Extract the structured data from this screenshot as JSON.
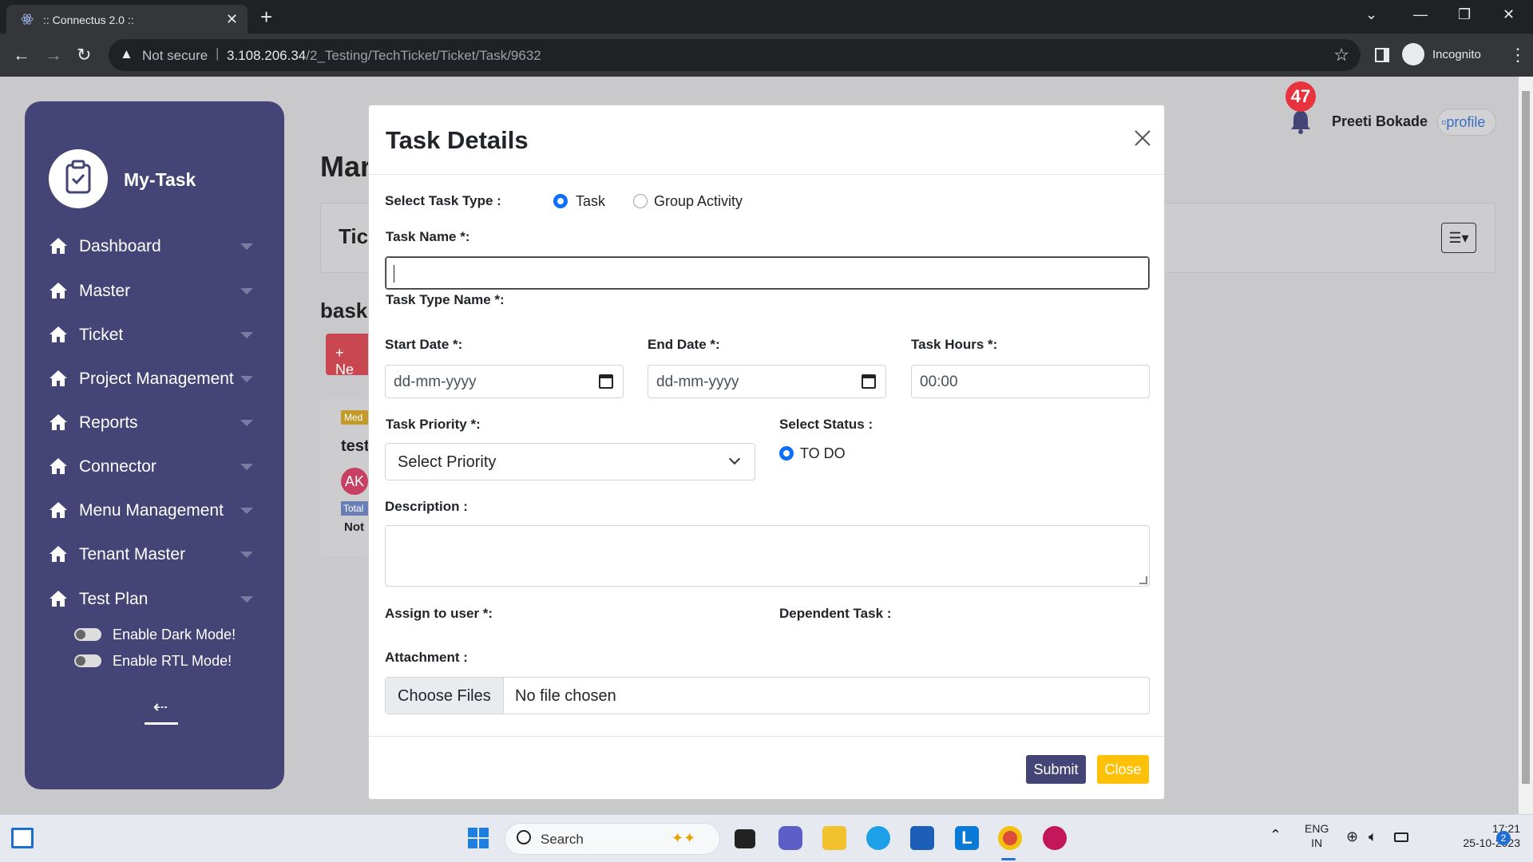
{
  "browser": {
    "tab_title": ":: Connectus 2.0 ::",
    "not_secure": "Not secure",
    "url_host": "3.108.206.34",
    "url_path": "/2_Testing/TechTicket/Ticket/Task/9632",
    "incognito": "Incognito"
  },
  "sidebar": {
    "brand": "My-Task",
    "items": [
      {
        "label": "Dashboard"
      },
      {
        "label": "Master"
      },
      {
        "label": "Ticket"
      },
      {
        "label": "Project Management"
      },
      {
        "label": "Reports"
      },
      {
        "label": "Connector"
      },
      {
        "label": "Menu Management"
      },
      {
        "label": "Tenant Master"
      },
      {
        "label": "Test Plan"
      }
    ],
    "dark_mode": "Enable Dark Mode!",
    "rtl_mode": "Enable RTL Mode!"
  },
  "header": {
    "notification_count": "47",
    "user_name": "Preeti Bokade",
    "profile_alt": "profile"
  },
  "background": {
    "title": "Mar",
    "card_title": "Tic",
    "section": "bask",
    "new_button": "+ Ne",
    "task_badge": "Med",
    "task_title": "test",
    "task_avatar": "AK",
    "task_total": "Total",
    "task_status": "Not"
  },
  "modal": {
    "title": "Task Details",
    "select_task_type_label": "Select Task Type :",
    "type_options": [
      "Task",
      "Group Activity"
    ],
    "task_name_label": "Task Name *:",
    "task_name_value": "",
    "task_type_name_label": "Task Type Name *:",
    "start_date_label": "Start Date *:",
    "start_date_placeholder": "dd-mm-yyyy",
    "end_date_label": "End Date *:",
    "end_date_placeholder": "dd-mm-yyyy",
    "task_hours_label": "Task Hours *:",
    "task_hours_value": "00:00",
    "priority_label": "Task Priority *:",
    "priority_selected": "Select Priority",
    "status_label": "Select Status :",
    "status_option": "TO DO",
    "description_label": "Description :",
    "assign_label": "Assign to user *:",
    "dependent_label": "Dependent Task :",
    "attachment_label": "Attachment :",
    "choose_files": "Choose Files",
    "no_file": "No file chosen",
    "submit": "Submit",
    "close": "Close"
  },
  "taskbar": {
    "search": "Search",
    "lang_top": "ENG",
    "lang_bottom": "IN",
    "time": "17:21",
    "date": "25-10-2023",
    "badge": "2"
  }
}
